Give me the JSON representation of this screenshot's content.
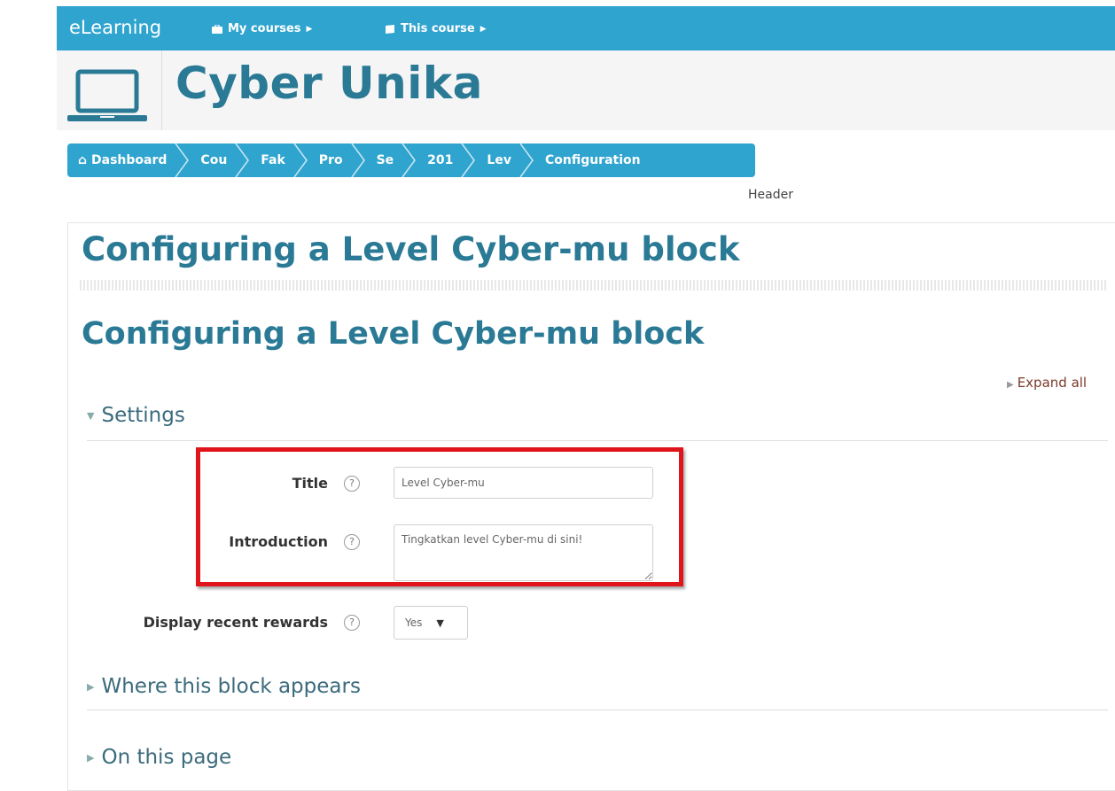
{
  "navbar": {
    "brand": "eLearning",
    "my_courses": "My courses",
    "this_course": "This course"
  },
  "site": {
    "title": "Cyber Unika"
  },
  "breadcrumb": {
    "items": [
      "Dashboard",
      "Cou",
      "Fak",
      "Pro",
      "Se",
      "201",
      "Lev",
      "Configuration"
    ]
  },
  "header_label": "Header",
  "page": {
    "heading": "Configuring a Level Cyber-mu block",
    "form_heading": "Configuring a Level Cyber-mu block",
    "expand_all": "Expand all"
  },
  "settings": {
    "title": "Settings",
    "fields": {
      "title_label": "Title",
      "title_value": "Level Cyber-mu",
      "intro_label": "Introduction",
      "intro_value": "Tingkatkan level Cyber-mu di sini!",
      "rewards_label": "Display recent rewards",
      "rewards_value": "Yes"
    },
    "help_glyph": "?"
  },
  "sections": {
    "where": "Where this block appears",
    "on_page": "On this page"
  },
  "colors": {
    "navbar": "#2fa4cf",
    "heading": "#2a7a96",
    "highlight": "#e0141b"
  }
}
